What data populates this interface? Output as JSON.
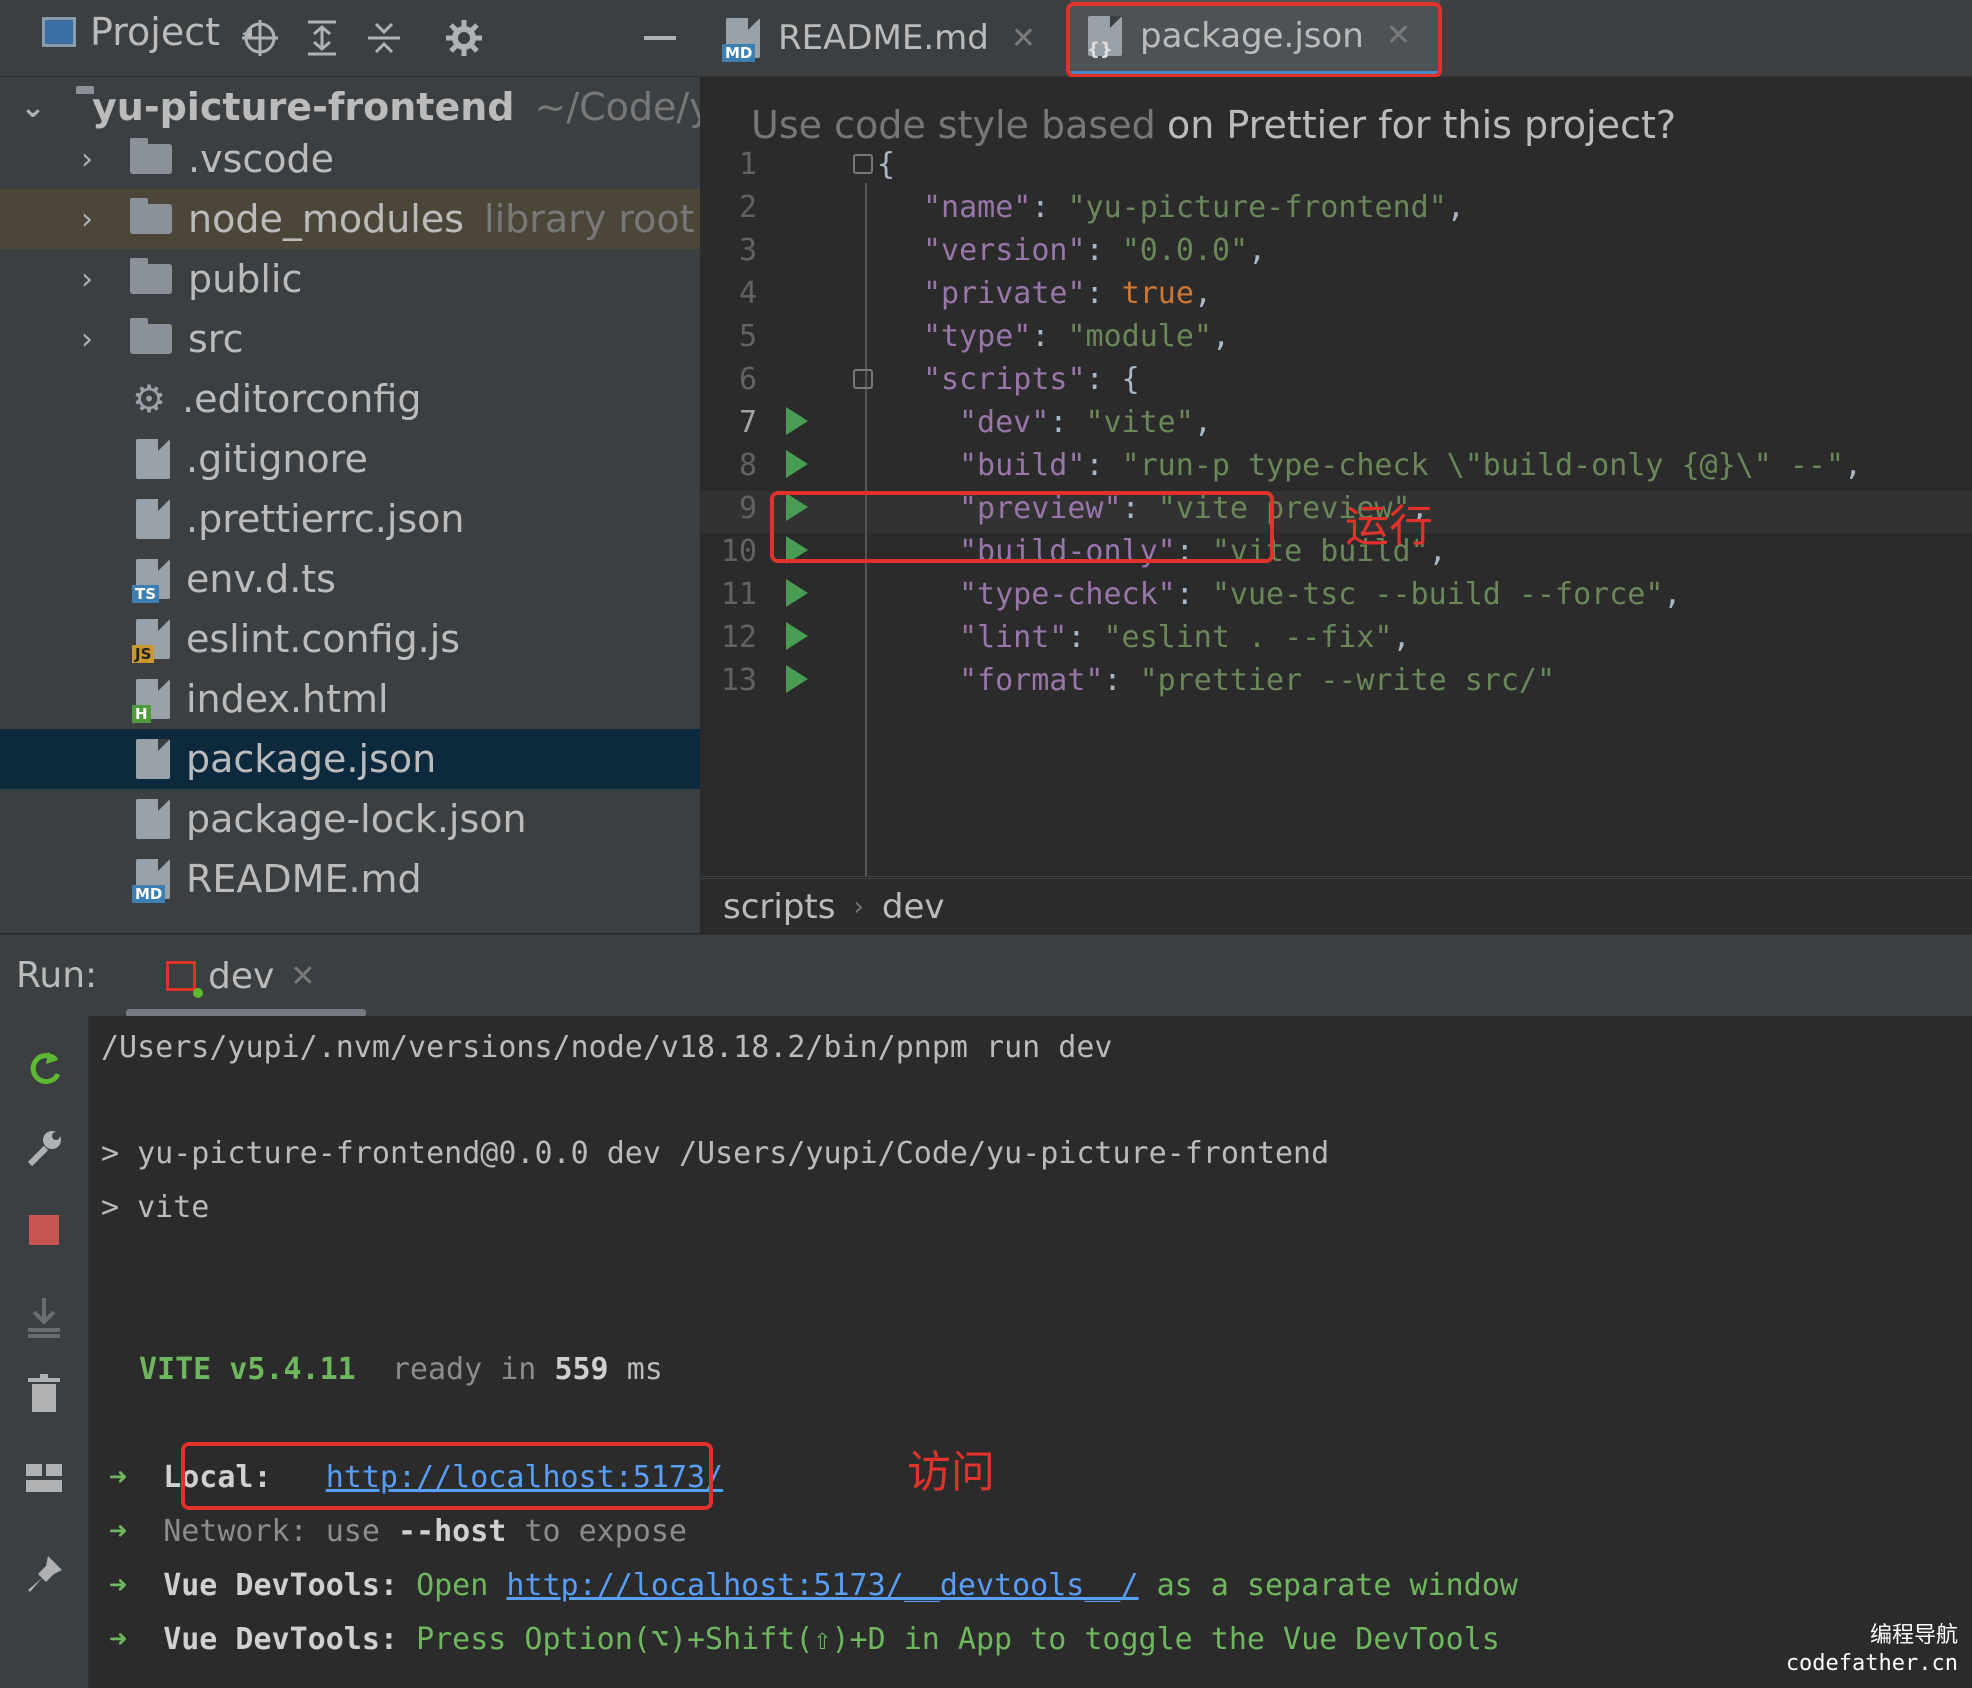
{
  "project": {
    "title": "Project",
    "tools": [
      "locate-icon",
      "expand-all-icon",
      "collapse-all-icon",
      "gear-icon",
      "minimize-icon"
    ]
  },
  "tabs": [
    {
      "label": "README.md",
      "badge": "MD"
    },
    {
      "label": "package.json",
      "badge": "{}"
    }
  ],
  "tree": {
    "root": {
      "name": "yu-picture-frontend",
      "path": "~/Code/yu-picture-frontend"
    },
    "items": [
      {
        "name": ".vscode",
        "type": "folder"
      },
      {
        "name": "node_modules",
        "type": "folder",
        "hint": "library root"
      },
      {
        "name": "public",
        "type": "folder"
      },
      {
        "name": "src",
        "type": "folder"
      },
      {
        "name": ".editorconfig",
        "type": "config"
      },
      {
        "name": ".gitignore",
        "type": "file"
      },
      {
        "name": ".prettierrc.json",
        "type": "json"
      },
      {
        "name": "env.d.ts",
        "type": "ts",
        "badge": "TS"
      },
      {
        "name": "eslint.config.js",
        "type": "js",
        "badge": "JS"
      },
      {
        "name": "index.html",
        "type": "html",
        "badge": "H"
      },
      {
        "name": "package.json",
        "type": "json"
      },
      {
        "name": "package-lock.json",
        "type": "json"
      },
      {
        "name": "README.md",
        "type": "md",
        "badge": "MD"
      }
    ]
  },
  "editor": {
    "banner_ghost": "Use code style based",
    "banner": "on Prettier for this project?",
    "line_numbers": [
      "1",
      "2",
      "3",
      "4",
      "5",
      "6",
      "7",
      "8",
      "9",
      "10",
      "11",
      "12",
      "13"
    ],
    "lines": {
      "l1": "{",
      "l2k": "\"name\"",
      "l2v": "\"yu-picture-frontend\"",
      "l3k": "\"version\"",
      "l3v": "\"0.0.0\"",
      "l4k": "\"private\"",
      "l4v": "true",
      "l5k": "\"type\"",
      "l5v": "\"module\"",
      "l6k": "\"scripts\"",
      "l7k": "\"dev\"",
      "l7v": "\"vite\"",
      "l8k": "\"build\"",
      "l8v": "\"run-p type-check \\\"build-only {@}\\\" --\"",
      "l9k": "\"preview\"",
      "l9v": "\"vite preview\"",
      "l10k": "\"build-only\"",
      "l10v": "\"vite build\"",
      "l11k": "\"type-check\"",
      "l11v": "\"vue-tsc --build --force\"",
      "l12k": "\"lint\"",
      "l12v": "\"eslint . --fix\"",
      "l13k": "\"format\"",
      "l13v": "\"prettier --write src/\""
    },
    "annotation_run": "运行",
    "breadcrumb": [
      "scripts",
      "dev"
    ]
  },
  "run": {
    "label": "Run:",
    "tab": "dev",
    "console": {
      "cmd": "/Users/yupi/.nvm/versions/node/v18.18.2/bin/pnpm run dev",
      "script1": "> yu-picture-frontend@0.0.0 dev /Users/yupi/Code/yu-picture-frontend",
      "script2": "> vite",
      "vite": "VITE v5.4.11",
      "ready": "ready in",
      "ready_ms": "559",
      "ms": "ms",
      "local_label": "Local:",
      "local_url": "http://localhost:5173/",
      "network_label": "Network:",
      "network_use": "use",
      "network_flag": "--host",
      "network_tail": "to expose",
      "devtools_label": "Vue DevTools:",
      "devtools_open": "Open",
      "devtools_url": "http://localhost:5173/__devtools__/",
      "devtools_tail": "as a separate window",
      "devtools2_label": "Vue DevTools:",
      "devtools2_text": "Press Option(⌥)+Shift(⇧)+D in App to toggle the Vue DevTools"
    },
    "annotation_visit": "访问"
  },
  "watermark": [
    "编程导航",
    "codefather.cn"
  ],
  "colors": {
    "highlight": "#e0322a",
    "run_green": "#499c54",
    "link": "#589df6"
  }
}
